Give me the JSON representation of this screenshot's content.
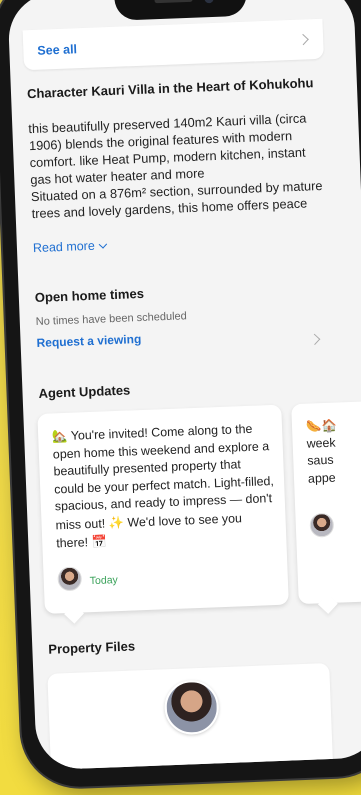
{
  "listing": {
    "see_all": "See all",
    "title": "Character Kauri Villa in the Heart of Kohukohu",
    "description_lines": [
      "this beautifully preserved 140m2 Kauri villa (circa",
      "1906) blends the original features with modern",
      "comfort. like Heat Pump, modern kitchen, instant",
      "gas hot water heater and more",
      "Situated on a 876m² section, surrounded by mature",
      "trees and lovely gardens, this home offers peace"
    ],
    "read_more": "Read more"
  },
  "open_home": {
    "title": "Open home times",
    "status": "No times have been scheduled",
    "request_link": "Request a viewing"
  },
  "agent_updates": {
    "title": "Agent Updates",
    "cards": [
      {
        "lead_icon": "🏡",
        "message": "You're invited! Come along to the open home this weekend and explore a beautifully presented property that could be your perfect match. Light-filled, spacious, and ready to impress — don't miss out!",
        "sparkle": "✨",
        "message_end": "We'd love to see you there!",
        "calendar": "📅",
        "time": "Today"
      },
      {
        "lead_icon": "🌭🏠",
        "fragment_lines": [
          "week",
          "saus",
          "appe"
        ]
      }
    ]
  },
  "property_files": {
    "title": "Property Files"
  }
}
